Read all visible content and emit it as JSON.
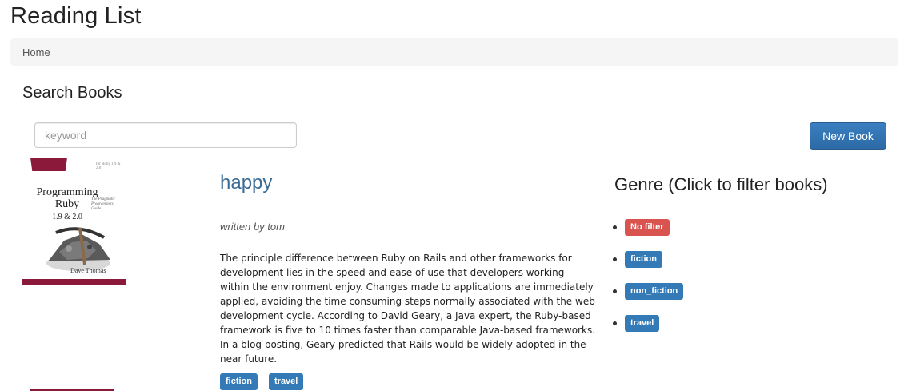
{
  "app": {
    "title": "Reading List"
  },
  "breadcrumb": {
    "home": "Home"
  },
  "search": {
    "section_title": "Search Books",
    "placeholder": "keyword",
    "value": ""
  },
  "toolbar": {
    "new_book_label": "New Book"
  },
  "book": {
    "title": "happy",
    "author_line": "written by tom",
    "description": "The principle difference between Ruby on Rails and other frameworks for development lies in the speed and ease of use that developers working within the environment enjoy. Changes made to applications are immediately applied, avoiding the time consuming steps normally associated with the web development cycle. According to David Geary, a Java expert, the Ruby-based framework is five to 10 times faster than comparable Java-based frameworks. In a blog posting, Geary predicted that Rails would be widely adopted in the near future.",
    "tags": [
      "fiction",
      "travel"
    ],
    "cover": {
      "title_line1": "Programming",
      "title_line2": "Ruby",
      "edition": "1.9 & 2.0",
      "subtitle": "The Pragmatic Programmers' Guide",
      "author": "Dave Thomas",
      "versions": "for Ruby 1.9 & 2.0"
    }
  },
  "genre": {
    "title": "Genre (Click to filter books)",
    "items": [
      {
        "label": "No filter",
        "color": "#d9534f"
      },
      {
        "label": "fiction",
        "color": "#337ab7"
      },
      {
        "label": "non_fiction",
        "color": "#337ab7"
      },
      {
        "label": "travel",
        "color": "#337ab7"
      }
    ]
  },
  "colors": {
    "accent": "#337ab7",
    "danger": "#d9534f",
    "title_link": "#3a6d96",
    "button": "#2d6aa6"
  }
}
